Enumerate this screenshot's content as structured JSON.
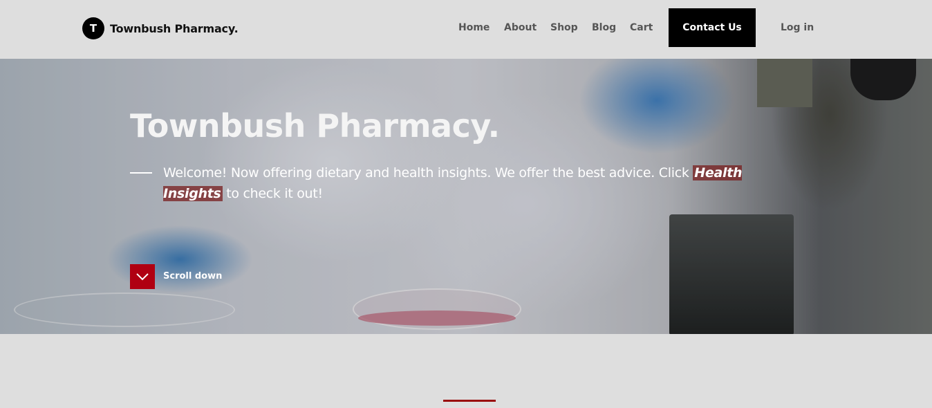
{
  "brand": {
    "logo_letter": "T",
    "name": "Townbush Pharmacy."
  },
  "nav": {
    "home": "Home",
    "about": "About",
    "shop": "Shop",
    "blog": "Blog",
    "cart": "Cart",
    "contact": "Contact Us",
    "login": "Log in"
  },
  "hero": {
    "title": "Townbush Pharmacy.",
    "text_before": "Welcome! Now offering dietary and health insights. We offer the best advice. Click ",
    "highlight": "Health Insights",
    "text_after": " to check it out!",
    "scroll_label": "Scroll down"
  },
  "colors": {
    "accent": "#b00012",
    "header_bg": "#dedede",
    "button_bg": "#000000",
    "underline": "#9a0d0d"
  },
  "icons": {
    "scroll": "chevron-down-icon"
  }
}
